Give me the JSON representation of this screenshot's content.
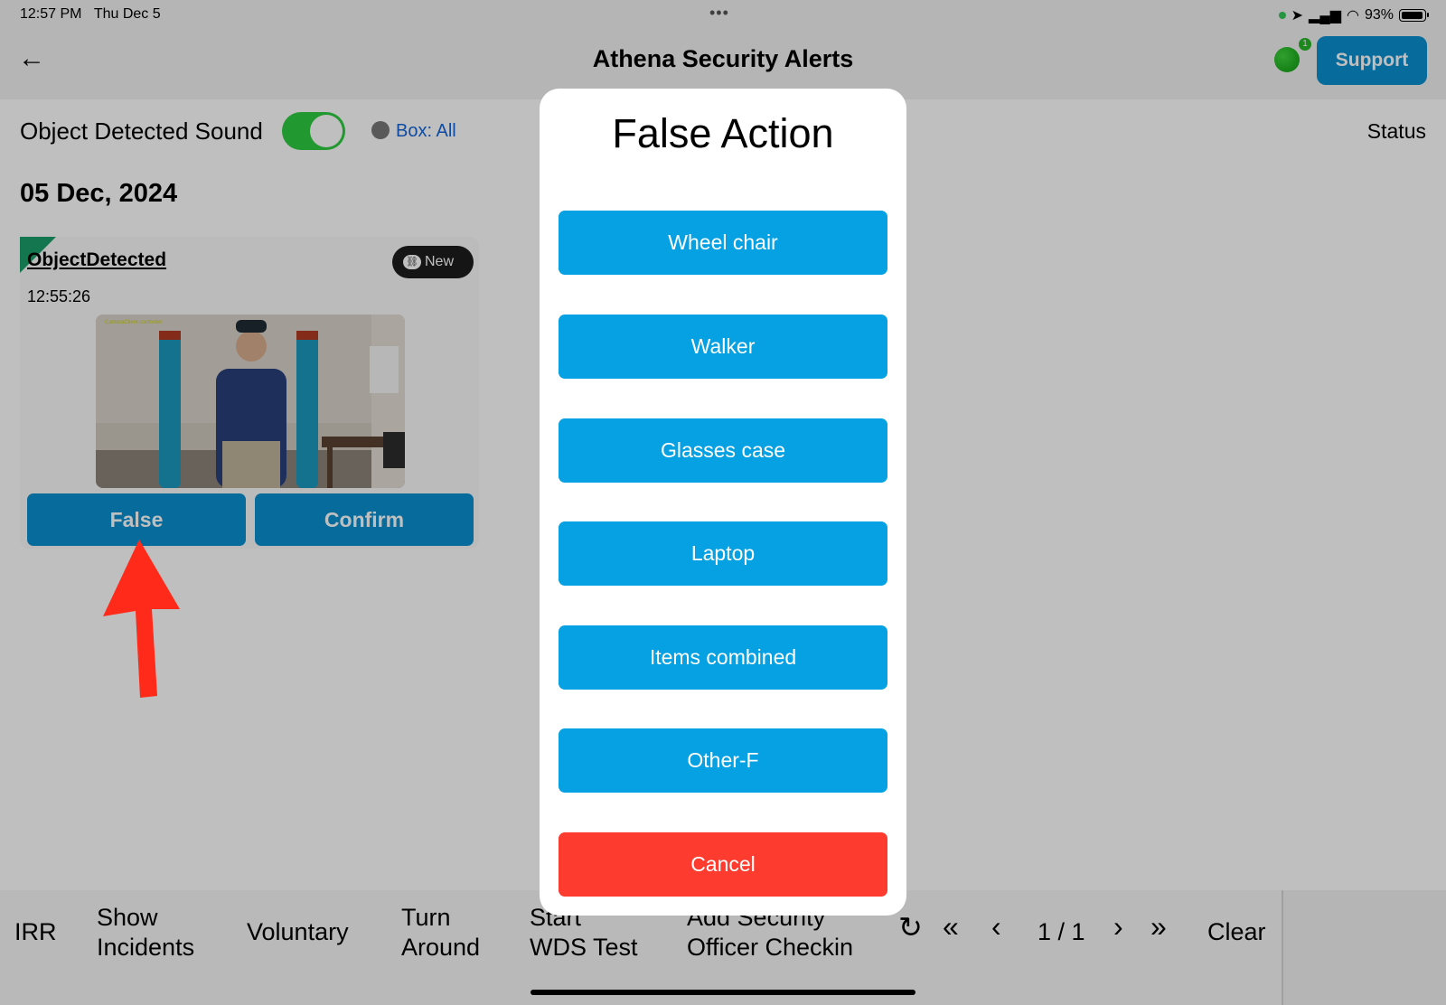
{
  "status_bar": {
    "time": "12:57 PM",
    "date": "Thu Dec 5",
    "battery": "93%"
  },
  "nav": {
    "title": "Athena Security Alerts",
    "notification_count": "1",
    "support_label": "Support"
  },
  "toolbar": {
    "sound_label": "Object Detected Sound",
    "sound_enabled": true,
    "box_filter": "Box: All",
    "status_label": "Status"
  },
  "date_header": "05 Dec, 2024",
  "alert": {
    "title": "ObjectDetected",
    "badge": "New",
    "time": "12:55:26",
    "snapshot_text": "CameraClient-controller",
    "false_label": "False",
    "confirm_label": "Confirm"
  },
  "bottom_bar": {
    "irr": "IRR",
    "show_incidents": [
      "Show",
      "Incidents"
    ],
    "voluntary": "Voluntary",
    "turn_around": [
      "Turn",
      "Around"
    ],
    "start_wds": [
      "Start",
      "WDS Test"
    ],
    "add_security": [
      "Add Security",
      "Officer Checkin"
    ],
    "page": "1 / 1",
    "clear": "Clear"
  },
  "modal": {
    "title": "False Action",
    "options": [
      "Wheel chair",
      "Walker",
      "Glasses case",
      "Laptop",
      "Items combined",
      "Other-F"
    ],
    "cancel": "Cancel"
  },
  "colors": {
    "accent_blue": "#0a8fd1",
    "option_blue": "#05a1e2",
    "cancel_red": "#fe3b2f",
    "toggle_green": "#2ecc40",
    "annotation_red": "#ff2a1a"
  },
  "icons": [
    "back-arrow-icon",
    "signal-icon",
    "wifi-icon",
    "battery-icon",
    "link-icon",
    "refresh-icon",
    "first-page-icon",
    "prev-page-icon",
    "next-page-icon",
    "last-page-icon"
  ]
}
